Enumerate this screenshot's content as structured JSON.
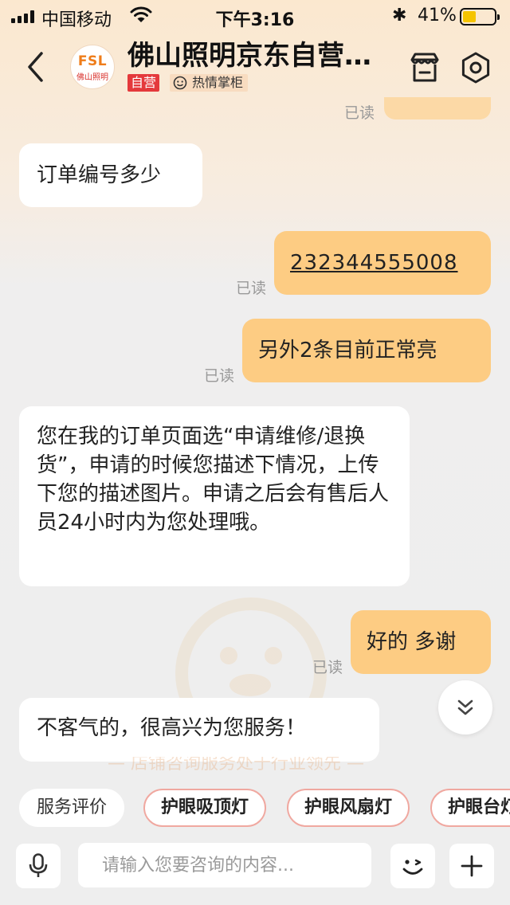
{
  "status_bar": {
    "carrier": "中国移动",
    "time": "下午3:16",
    "battery_percent": "41%",
    "battery_level": 0.41,
    "icons": [
      "signal-icon",
      "wifi-icon",
      "bluetooth-icon",
      "battery-icon"
    ]
  },
  "header": {
    "logo_text": "FSL",
    "logo_subtext": "佛山照明",
    "shop_name": "佛山照明京东自营…",
    "tag_self_operated": "自营",
    "tag_warm": "热情掌柜",
    "icons": [
      "back-icon",
      "store-icon",
      "settings-icon"
    ]
  },
  "messages": [
    {
      "side": "left",
      "text": "订单编号多少"
    },
    {
      "side": "right",
      "text": "232344555008",
      "read_label": "已读",
      "is_link": true
    },
    {
      "side": "right",
      "text": "另外2条目前正常亮",
      "read_label": "已读"
    },
    {
      "side": "left",
      "text": "您在我的订单页面选“申请维修/退换货”，申请的时候您描述下情况，上传下您的描述图片。申请之后会有售后人员24小时内为您处理哦。"
    },
    {
      "side": "right",
      "text": "好的 多谢",
      "read_label": "已读"
    },
    {
      "side": "left",
      "text": "不客气的，很高兴为您服务！"
    }
  ],
  "top_read_label": "已读",
  "ghost_note": "— 店铺咨询服务处于行业领先 —",
  "quick_chips": [
    "服务评价",
    "护眼吸顶灯",
    "护眼风扇灯",
    "护眼台灯"
  ],
  "input": {
    "placeholder": "请输入您要咨询的内容..."
  },
  "colors": {
    "bubble_right": "#fdcc83",
    "bubble_left": "#ffffff",
    "tag_red": "#e4393c",
    "brand_orange": "#ef7d1b"
  }
}
